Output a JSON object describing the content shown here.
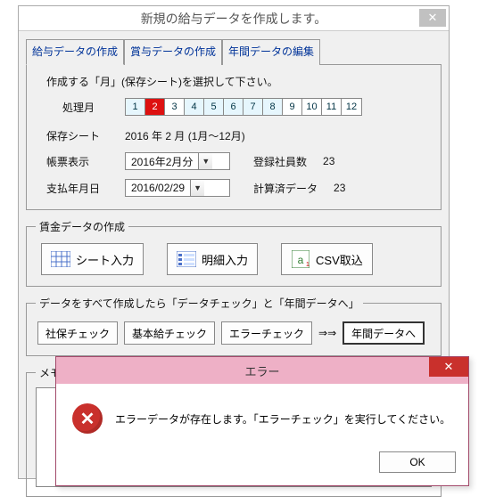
{
  "window": {
    "title": "新規の給与データを作成します。"
  },
  "tabs": {
    "t1": "給与データの作成",
    "t2": "賞与データの作成",
    "t3": "年間データの編集"
  },
  "page": {
    "monthPrompt": "作成する「月」(保存シート)を選択して下さい。",
    "procMonthLabel": "処理月",
    "months": [
      "1",
      "2",
      "3",
      "4",
      "5",
      "6",
      "7",
      "8",
      "9",
      "10",
      "11",
      "12"
    ],
    "selectedMonth": 2,
    "saveSheetLabel": "保存シート",
    "saveSheetValue": "2016  年  2  月  (1月～12月)",
    "formDispLabel": "帳票表示",
    "formDispCombo": "2016年2月分",
    "regEmpLabel": "登録社員数",
    "regEmpValue": "23",
    "payDateLabel": "支払年月日",
    "payDateCombo": "2016/02/29",
    "calcDoneLabel": "計算済データ",
    "calcDoneValue": "23"
  },
  "wage": {
    "legend": "賃金データの作成",
    "btnSheet": "シート入力",
    "btnDetail": "明細入力",
    "btnCsv": "CSV取込"
  },
  "flow": {
    "legend": "データをすべて作成したら「データチェック」と「年間データへ」",
    "btnShaho": "社保チェック",
    "btnKihon": "基本給チェック",
    "btnError": "エラーチェック",
    "arrow": "⇒⇒",
    "btnAnnual": "年間データへ"
  },
  "memo": {
    "legend": "メモ  (改行はCtrlキーを押しながらEnterを押して下さい。)"
  },
  "dialog": {
    "title": "エラー",
    "message": "エラーデータが存在します。「エラーチェック」を実行してください。",
    "ok": "OK"
  }
}
